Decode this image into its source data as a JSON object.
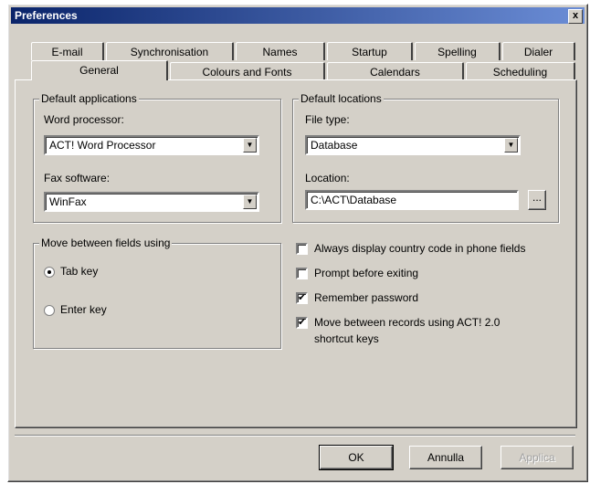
{
  "window": {
    "title": "Preferences",
    "close_label": "x"
  },
  "tabs_row1": [
    "E-mail",
    "Synchronisation",
    "Names",
    "Startup",
    "Spelling",
    "Dialer"
  ],
  "tabs_row2": [
    "General",
    "Colours and Fonts",
    "Calendars",
    "Scheduling"
  ],
  "active_tab": "General",
  "default_applications": {
    "title": "Default applications",
    "word_processor_label": "Word processor:",
    "word_processor_value": "ACT! Word Processor",
    "fax_label": "Fax software:",
    "fax_value": "WinFax"
  },
  "default_locations": {
    "title": "Default locations",
    "file_type_label": "File type:",
    "file_type_value": "Database",
    "location_label": "Location:",
    "location_value": "C:\\ACT\\Database",
    "browse_label": "..."
  },
  "move_between_fields": {
    "title": "Move between fields using",
    "options": [
      {
        "label": "Tab key",
        "checked": true
      },
      {
        "label": "Enter key",
        "checked": false
      }
    ]
  },
  "checkboxes": [
    {
      "label": "Always display country code in phone fields",
      "checked": false
    },
    {
      "label": "Prompt before exiting",
      "checked": false
    },
    {
      "label": "Remember password",
      "checked": true
    },
    {
      "label": "Move between records using ACT! 2.0",
      "label2": "shortcut keys",
      "checked": true
    }
  ],
  "buttons": {
    "ok": "OK",
    "cancel": "Annulla",
    "apply": "Applica"
  },
  "check_mark": "✔",
  "combo_arrow": "▼"
}
